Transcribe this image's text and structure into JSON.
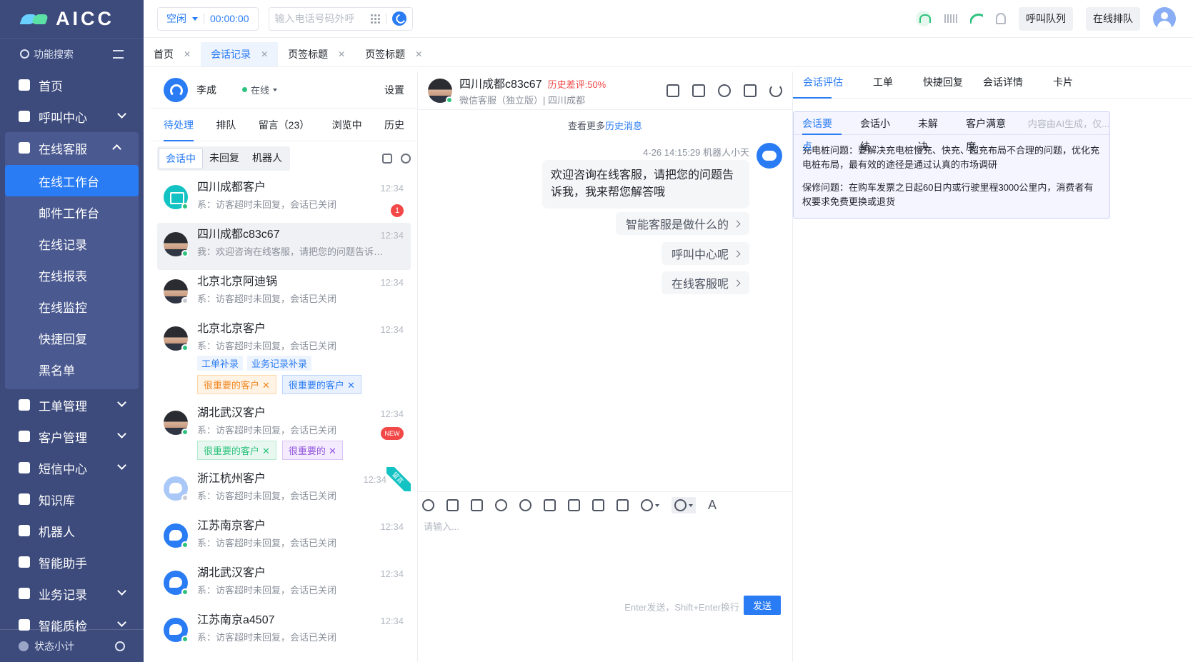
{
  "app": {
    "logo_text": "AICC",
    "accent": "#2a7cf4",
    "sidebar_bg": "#3c4a7c"
  },
  "sidebar": {
    "search_label": "功能搜索",
    "items": [
      {
        "label": "首页",
        "icon": "home-icon"
      },
      {
        "label": "呼叫中心",
        "icon": "phone-icon",
        "expandable": true
      },
      {
        "label": "在线客服",
        "icon": "chat-icon",
        "expandable": true,
        "open": true
      },
      {
        "label": "工单管理",
        "icon": "ticket-icon",
        "expandable": true
      },
      {
        "label": "客户管理",
        "icon": "customer-icon",
        "expandable": true
      },
      {
        "label": "短信中心",
        "icon": "sms-icon",
        "expandable": true
      },
      {
        "label": "知识库",
        "icon": "knowledge-icon"
      },
      {
        "label": "机器人",
        "icon": "robot-icon"
      },
      {
        "label": "智能助手",
        "icon": "assistant-icon"
      },
      {
        "label": "业务记录",
        "icon": "record-icon",
        "expandable": true
      },
      {
        "label": "智能质检",
        "icon": "quality-icon",
        "expandable": true
      }
    ],
    "sub_items": [
      "在线工作台",
      "邮件工作台",
      "在线记录",
      "在线报表",
      "在线监控",
      "快捷回复",
      "黑名单"
    ],
    "footer_label": "状态小计"
  },
  "topbar": {
    "status": "空闲",
    "timer": "00:00:00",
    "dial_placeholder": "输入电话号码外呼",
    "call_queue_btn": "呼叫队列",
    "online_queue_btn": "在线排队"
  },
  "page_tabs": [
    {
      "label": "首页",
      "active": false
    },
    {
      "label": "会话记录",
      "active": true
    },
    {
      "label": "页签标题",
      "active": false
    },
    {
      "label": "页签标题",
      "active": false
    }
  ],
  "list": {
    "agent_name": "李成",
    "agent_status": "在线",
    "settings": "设置",
    "tabs": [
      "待处理",
      "排队",
      "留言（23）",
      "浏览中",
      "历史"
    ],
    "filters": [
      "会话中",
      "未回复",
      "机器人"
    ],
    "conversations": [
      {
        "name": "四川成都客户",
        "msg": "系：访客超时未回复，会话已关闭",
        "time": "12:34",
        "badge": "1"
      },
      {
        "name": "四川成都c83c67",
        "msg": "我：欢迎咨询在线客服，请把您的问题告诉我，我来帮您解答哦",
        "time": "12:34"
      },
      {
        "name": "北京北京阿迪锅",
        "msg": "系：访客超时未回复，会话已关闭",
        "time": "12:34"
      },
      {
        "name": "北京北京客户",
        "msg": "系：访客超时未回复，会话已关闭",
        "time": "12:34",
        "links": [
          "工单补录",
          "业务记录补录"
        ],
        "tags": [
          "很重要的客户",
          "很重要的客户"
        ]
      },
      {
        "name": "湖北武汉客户",
        "msg": "系：访客超时未回复，会话已关闭",
        "time": "12:34",
        "badge": "NEW",
        "tags": [
          "很重要的客户",
          "很重要的"
        ]
      },
      {
        "name": "浙江杭州客户",
        "msg": "系：访客超时未回复，会话已关闭",
        "time": "12:34",
        "ribbon": "留言"
      },
      {
        "name": "江苏南京客户",
        "msg": "系：访客超时未回复，会话已关闭",
        "time": "12:34"
      },
      {
        "name": "湖北武汉客户",
        "msg": "系：访客超时未回复，会话已关闭",
        "time": "12:34"
      },
      {
        "name": "江苏南京a4507",
        "msg": "系：访客超时未回复，会话已关闭",
        "time": "12:34"
      }
    ]
  },
  "chat": {
    "name": "四川成都c83c67",
    "history_rating": "历史差评:50%",
    "sub": "微信客服（独立版）| 四川成都",
    "more_history_prefix": "查看更多",
    "more_history_link": "历史消息",
    "meta": "4-26 14:15:29 机器人小天",
    "bubble": "欢迎咨询在线客服，请把您的问题告诉我，我来帮您解答哦",
    "quick_replies": [
      "智能客服是做什么的",
      "呼叫中心呢",
      "在线客服呢"
    ],
    "input_placeholder": "请输入...",
    "send_hint": "Enter发送，Shift+Enter换行",
    "send_btn": "发送"
  },
  "right": {
    "tabs": [
      "会话评估",
      "工单",
      "快捷回复",
      "会话详情",
      "卡片"
    ],
    "ai_tabs": [
      "会话要点",
      "会话小结",
      "未解决",
      "客户满意度"
    ],
    "ai_note": "内容由AI生成，仅...",
    "points": [
      "充电桩问题：要解决充电桩慢充、快充、超充布局不合理的问题，优化充电桩布局，最有效的途径是通过认真的市场调研",
      "保修问题：在购车发票之日起60日内或行驶里程3000公里内，消费者有权要求免费更换或退货"
    ]
  }
}
